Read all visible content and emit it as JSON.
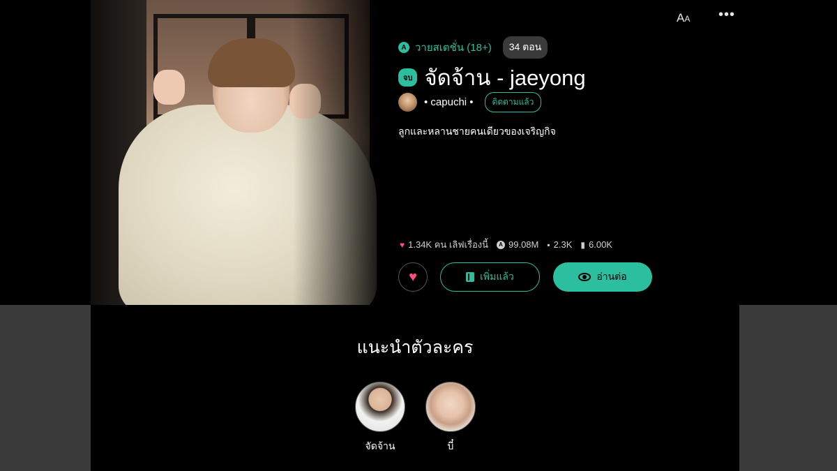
{
  "toolbar": {
    "font_size_label_big": "A",
    "font_size_label_small": "A",
    "more_label": "•••"
  },
  "story": {
    "genre": "วายสเตชั่น (18+)",
    "genre_icon_letter": "A",
    "episode_count": "34 ตอน",
    "status_badge": "จบ",
    "title": "จัดจ้าน - jaeyong",
    "author": "• capuchi •",
    "follow_label": "ติดตามแล้ว",
    "synopsis": "ลูกและหลานชายคนเดียวของเจริญกิจ"
  },
  "stats": {
    "likes": "1.34K คน เลิฟเรื่องนี้",
    "views": "99.08M",
    "comments": "2.3K",
    "bookmarks": "6.00K"
  },
  "actions": {
    "like_icon": "♥",
    "added_label": "เพิ่มแล้ว",
    "read_label": "อ่านต่อ"
  },
  "characters": {
    "heading": "แนะนำตัวละคร",
    "items": [
      {
        "name": "จัดจ้าน"
      },
      {
        "name": "บี๋"
      }
    ]
  },
  "colors": {
    "accent": "#2bbfa0",
    "heart": "#ff4d7d",
    "background": "#000000",
    "band": "#3a3a3a"
  },
  "icons": [
    "font-size-icon",
    "more-icon",
    "genre-icon",
    "heart-icon",
    "views-icon",
    "comment-icon",
    "bookmark-icon",
    "book-icon",
    "eye-icon"
  ]
}
